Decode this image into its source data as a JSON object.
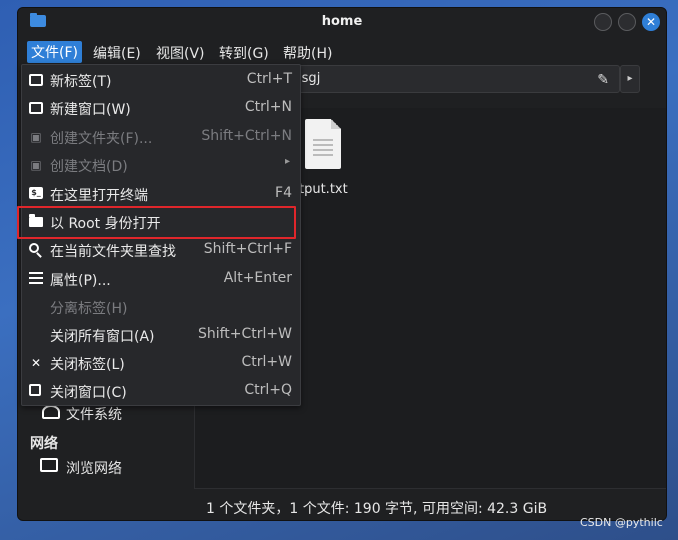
{
  "window": {
    "title": "home",
    "close_symbol": "✕"
  },
  "menubar": {
    "items": [
      {
        "label": "文件(F)"
      },
      {
        "label": "编辑(E)"
      },
      {
        "label": "视图(V)"
      },
      {
        "label": "转到(G)"
      },
      {
        "label": "帮助(H)"
      }
    ]
  },
  "path": {
    "value": "msgj",
    "edit_icon": "pencil-icon",
    "arrow": "▸"
  },
  "files": [
    {
      "label": "tput.txt",
      "icon": "text-file-icon"
    }
  ],
  "sidebar": {
    "items": [
      {
        "label": "文件系统",
        "icon": "drive-icon"
      },
      {
        "label": "浏览网络",
        "icon": "network-icon"
      }
    ],
    "network_header": "网络"
  },
  "statusbar": {
    "text": "1 个文件夹，1 个文件: 190 字节, 可用空间: 42.3 GiB"
  },
  "file_menu": {
    "items": [
      {
        "label": "新标签(T)",
        "shortcut": "Ctrl+T",
        "icon": "new-tab-icon",
        "disabled": false
      },
      {
        "label": "新建窗口(W)",
        "shortcut": "Ctrl+N",
        "icon": "new-window-icon",
        "disabled": false
      },
      {
        "label": "创建文件夹(F)...",
        "shortcut": "Shift+Ctrl+N",
        "icon": "new-folder-icon",
        "disabled": true
      },
      {
        "label": "创建文档(D)",
        "shortcut": "",
        "icon": "new-document-icon",
        "disabled": true
      },
      {
        "label": "在这里打开终端",
        "shortcut": "F4",
        "icon": "terminal-icon",
        "disabled": false
      },
      {
        "label": "以 Root 身份打开",
        "shortcut": "",
        "icon": "folder-icon",
        "disabled": false
      },
      {
        "label": "在当前文件夹里查找",
        "shortcut": "Shift+Ctrl+F",
        "icon": "search-icon",
        "disabled": false
      },
      {
        "label": "属性(P)...",
        "shortcut": "Alt+Enter",
        "icon": "properties-icon",
        "disabled": false
      },
      {
        "label": "分离标签(H)",
        "shortcut": "",
        "icon": "",
        "disabled": true
      },
      {
        "label": "关闭所有窗口(A)",
        "shortcut": "Shift+Ctrl+W",
        "icon": "",
        "disabled": false
      },
      {
        "label": "关闭标签(L)",
        "shortcut": "Ctrl+W",
        "icon": "close-icon",
        "disabled": false
      },
      {
        "label": "关闭窗口(C)",
        "shortcut": "Ctrl+Q",
        "icon": "exit-icon",
        "disabled": false
      }
    ],
    "submenu_arrow": "▸"
  },
  "watermark": "CSDN @pythilc",
  "colors": {
    "accent": "#2f7fd7",
    "highlight_box": "#e0262b"
  }
}
